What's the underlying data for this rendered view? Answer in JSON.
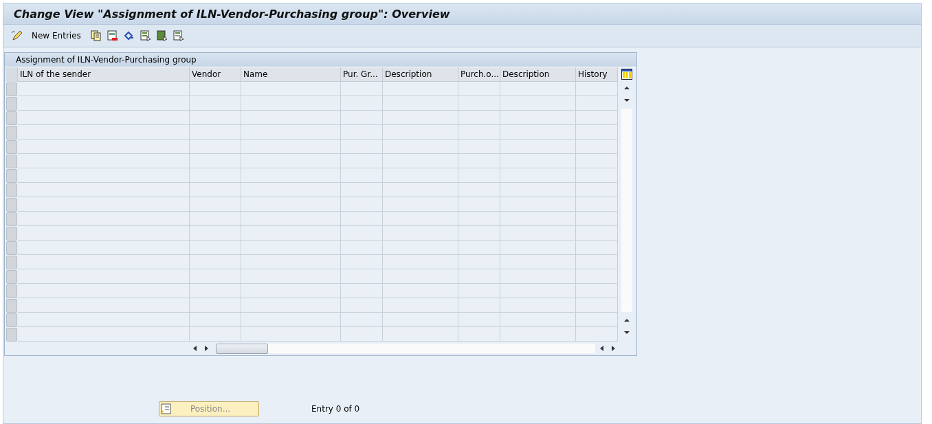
{
  "window": {
    "title": "Change View \"Assignment of ILN-Vendor-Purchasing group\": Overview"
  },
  "toolbar": {
    "new_entries": "New Entries"
  },
  "table": {
    "title": "Assignment of ILN-Vendor-Purchasing group",
    "columns": [
      "ILN of the sender",
      "Vendor",
      "Name",
      "Pur. Gr...",
      "Description",
      "Purch.o...",
      "Description",
      "History"
    ]
  },
  "footer": {
    "position_button": "Position...",
    "entry_count": "Entry 0 of 0"
  }
}
